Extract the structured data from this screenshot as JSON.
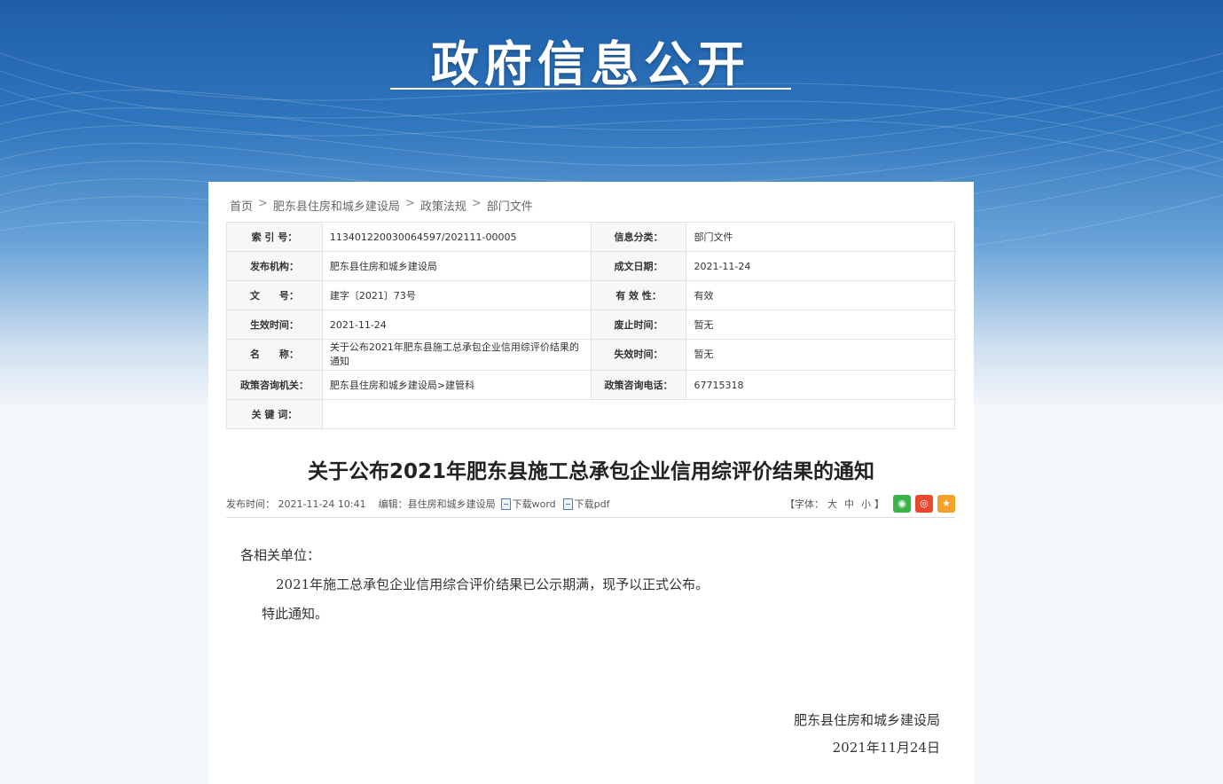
{
  "banner": {
    "title": "政府信息公开"
  },
  "breadcrumb": {
    "items": [
      "首页",
      "肥东县住房和城乡建设局",
      "政策法规",
      "部门文件"
    ],
    "sep": ">"
  },
  "meta": {
    "rows": [
      {
        "k1": "索 引 号：",
        "v1": "113401220030064597/202111-00005",
        "k2": "信息分类：",
        "v2": "部门文件"
      },
      {
        "k1": "发布机构：",
        "v1": "肥东县住房和城乡建设局",
        "k2": "成文日期：",
        "v2": "2021-11-24"
      },
      {
        "k1": "文　　号：",
        "v1": "建字〔2021〕73号",
        "k2": "有 效 性：",
        "v2": "有效"
      },
      {
        "k1": "生效时间：",
        "v1": "2021-11-24",
        "k2": "废止时间：",
        "v2": "暂无"
      },
      {
        "k1": "名　　称：",
        "v1": "关于公布2021年肥东县施工总承包企业信用综评价结果的通知",
        "k2": "失效时间：",
        "v2": "暂无"
      },
      {
        "k1": "政策咨询机关：",
        "v1": "肥东县住房和城乡建设局>建管科",
        "k2": "政策咨询电话：",
        "v2": "67715318"
      },
      {
        "k1": "关 键 词：",
        "v1": ""
      }
    ]
  },
  "article": {
    "title": "关于公布2021年肥东县施工总承包企业信用综评价结果的通知",
    "publish_time": "发布时间： 2021-11-24 10:41",
    "editor": "编辑：县住房和城乡建设局",
    "download_word": "下载word",
    "download_pdf": "下载pdf",
    "font_size_label": "【字体：",
    "font_large": "大",
    "font_medium": "中",
    "font_small": "小",
    "font_close": "】",
    "share_icons": [
      "wechat-icon",
      "weibo-icon",
      "favorite-icon"
    ],
    "greeting": "各相关单位：",
    "paragraph": "2021年施工总承包企业信用综合评价结果已公示期满，现予以正式公布。",
    "closing": "特此通知。",
    "signature_org": "肥东县住房和城乡建设局",
    "signature_date": "2021年11月24日"
  }
}
